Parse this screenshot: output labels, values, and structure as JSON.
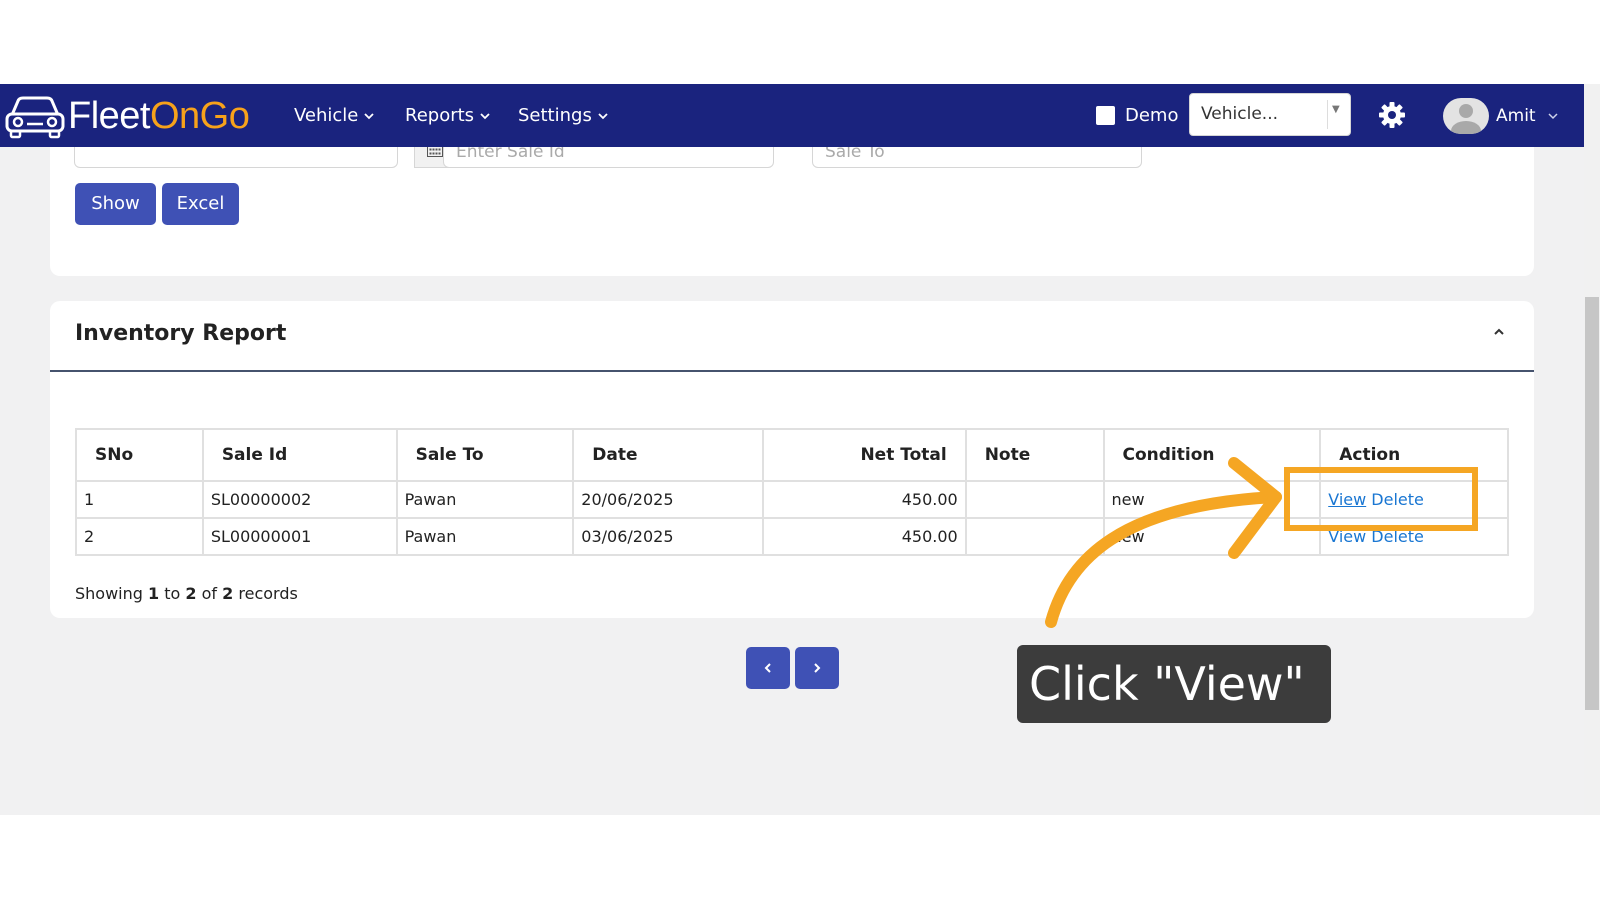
{
  "brand": {
    "part1": "Fleet",
    "part2": "OnGo"
  },
  "nav": {
    "menu": [
      "Vehicle",
      "Reports",
      "Settings"
    ],
    "demo_label": "Demo",
    "vehicle_select": "Vehicle...",
    "user_name": "Amit"
  },
  "filters": {
    "sale_id_placeholder": "Enter Sale Id",
    "sale_to_placeholder": "Sale To",
    "show_label": "Show",
    "excel_label": "Excel"
  },
  "report": {
    "title": "Inventory Report",
    "columns": [
      "SNo",
      "Sale Id",
      "Sale To",
      "Date",
      "Net Total",
      "Note",
      "Condition",
      "Action"
    ],
    "rows": [
      {
        "sno": "1",
        "sale_id": "SL00000002",
        "sale_to": "Pawan",
        "date": "20/06/2025",
        "net_total": "450.00",
        "note": "",
        "condition": "new",
        "view": "View",
        "delete": "Delete"
      },
      {
        "sno": "2",
        "sale_id": "SL00000001",
        "sale_to": "Pawan",
        "date": "03/06/2025",
        "net_total": "450.00",
        "note": "",
        "condition": "new",
        "view": "View",
        "delete": "Delete"
      }
    ],
    "records": {
      "prefix": "Showing",
      "from": "1",
      "to_word": "to",
      "to": "2",
      "of_word": "of",
      "total": "2",
      "suffix": "records"
    }
  },
  "pagination": {
    "prev": "‹",
    "next": "›"
  },
  "annotation": {
    "callout": "Click \"View\"",
    "accent": "#f5a623"
  },
  "colors": {
    "navbar": "#1a237e",
    "primary": "#3f51b5",
    "link": "#1976d2",
    "brand_accent": "#f7a21b"
  },
  "icons": [
    "car-logo-icon",
    "chevron-down-icon",
    "gear-icon",
    "user-avatar-icon",
    "calendar-icon",
    "chevron-up-icon",
    "arrow-icon"
  ]
}
